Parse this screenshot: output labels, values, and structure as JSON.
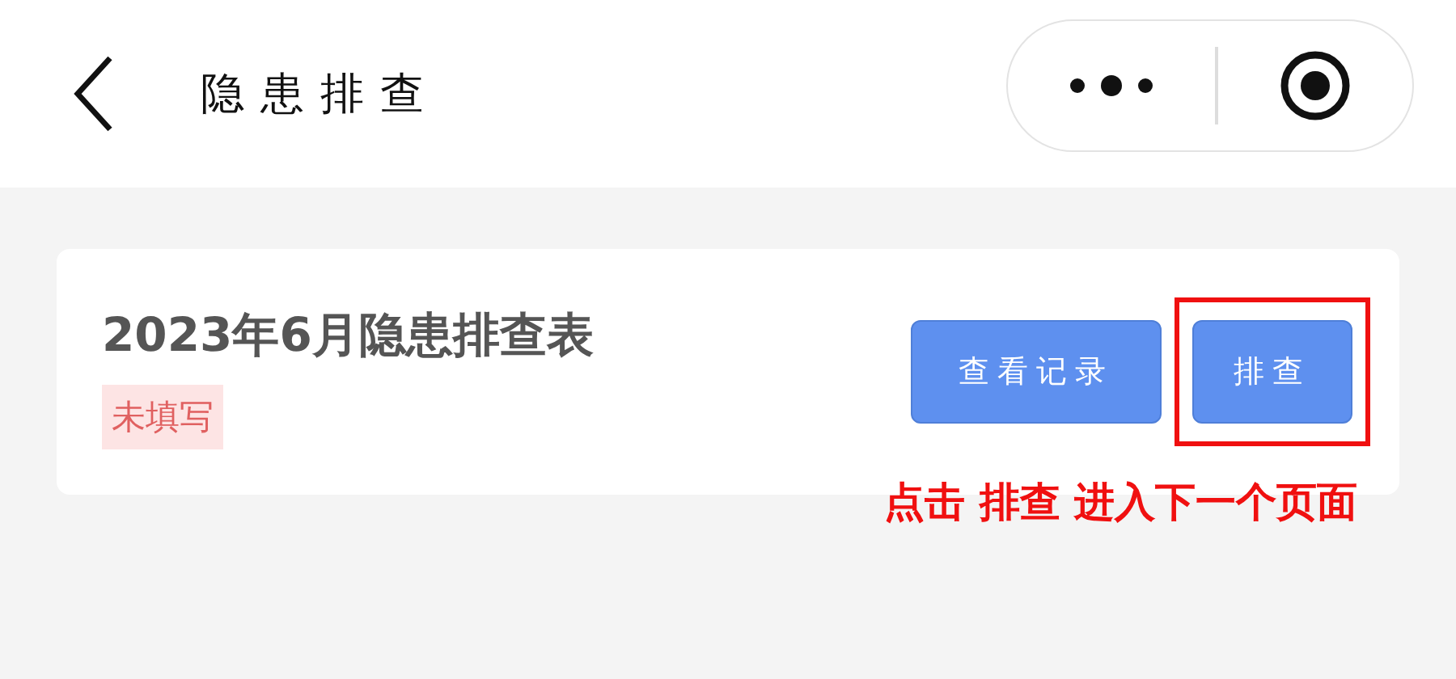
{
  "nav": {
    "title": "隐患排查"
  },
  "card": {
    "title": "2023年6月隐患排查表",
    "status": "未填写",
    "buttons": [
      {
        "label": "查看记录",
        "highlighted": false
      },
      {
        "label": "排查",
        "highlighted": true
      }
    ]
  },
  "annotation": {
    "text": "点击 排查 进入下一个页面"
  }
}
